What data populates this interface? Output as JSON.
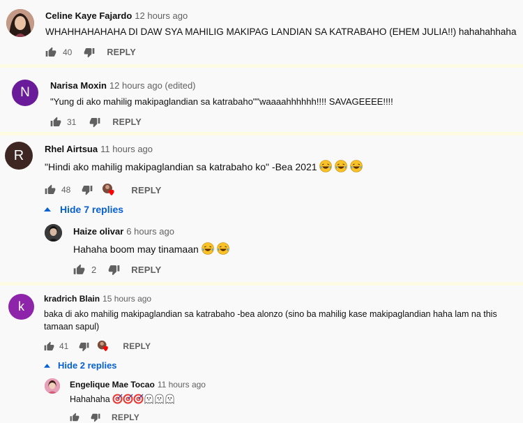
{
  "comments": [
    {
      "author": "Celine Kaye Fajardo",
      "time": "12 hours ago",
      "text": "WHAHHAHAHAHA DI DAW SYA MAHILIG MAKIPAG LANDIAN SA KATRABAHO (EHEM JULIA!!) hahahahhaha",
      "likes": "40",
      "reply_label": "REPLY",
      "avatar_color": "#8a4a3a"
    },
    {
      "author": "Narisa Moxin",
      "time": "12 hours ago (edited)",
      "text": "\"Yung di ako mahilig makipaglandian sa katrabaho\"\"waaaahhhhhh!!!! SAVAGEEEE!!!!",
      "likes": "31",
      "reply_label": "REPLY",
      "avatar_letter": "N",
      "avatar_color": "#6a1b9a"
    },
    {
      "author": "Rhel Airtsua",
      "time": "11 hours ago",
      "text": "\"Hindi ako mahilig makipaglandian sa katrabaho ko\" -Bea 2021",
      "likes": "48",
      "reply_label": "REPLY",
      "avatar_letter": "R",
      "avatar_color": "#3e2723",
      "toggle_label": "Hide 7 replies"
    },
    {
      "author": "Haize olivar",
      "time": "6 hours ago",
      "text": "Hahaha boom may tinamaan",
      "likes": "2",
      "reply_label": "REPLY",
      "avatar_color": "#2b2b2b"
    },
    {
      "author": "kradrich Blain",
      "time": "15 hours ago",
      "text_line1": "baka di ako mahilig makipaglandian sa katrabaho -bea alonzo (sino ba mahilig kase makipaglandian haha lam na this",
      "text_line2": "tamaan sapul)",
      "likes": "41",
      "reply_label": "REPLY",
      "avatar_letter": "k",
      "avatar_color": "#8e24aa",
      "toggle_label": "Hide 2 replies"
    },
    {
      "author": "Engelique Mae Tocao",
      "time": "11 hours ago",
      "text": "Hahahaha",
      "likes": "",
      "reply_label": "REPLY",
      "avatar_color": "#c2185b"
    }
  ],
  "icons": {
    "like": "thumbs-up-icon",
    "dislike": "thumbs-down-icon",
    "heart": "creator-heart-icon",
    "laugh": "laughing-emoji",
    "target": "bullseye-emoji",
    "ghost": "ghost-emoji",
    "chevron": "chevron-up-icon"
  },
  "colors": {
    "separator": "#fdfbe1",
    "link_blue": "#065fd4",
    "heart_red": "#ff0000"
  }
}
